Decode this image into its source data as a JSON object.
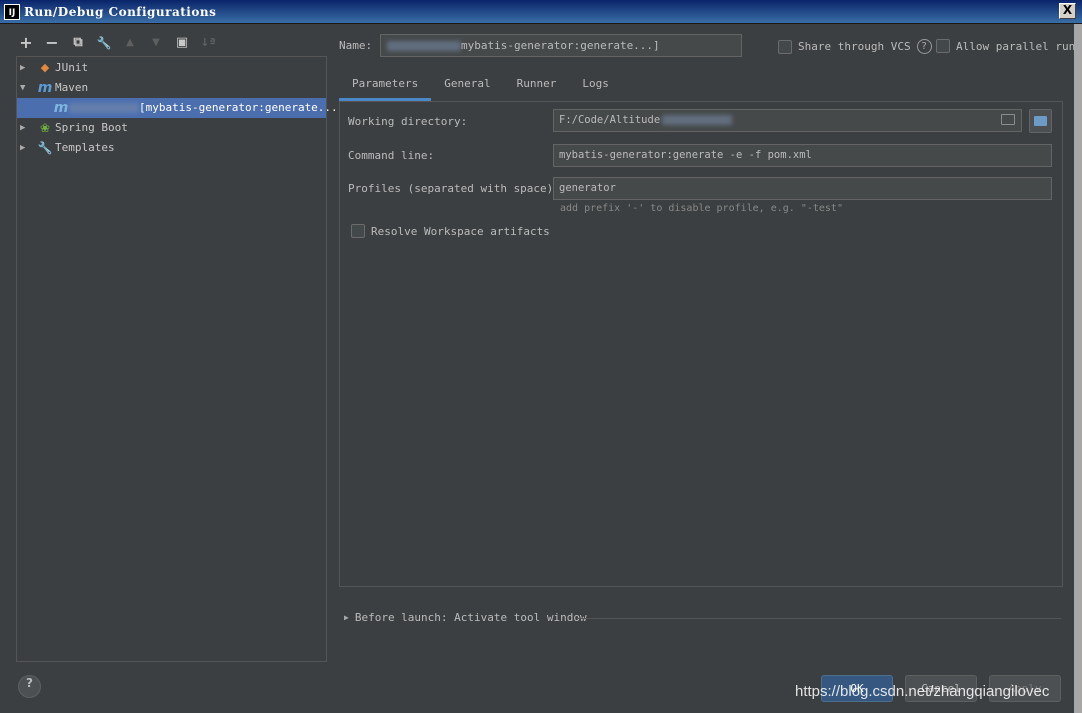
{
  "window": {
    "app_icon": "IJ",
    "title": "Run/Debug Configurations",
    "close": "X"
  },
  "toolbar": {
    "add": "+",
    "remove": "−",
    "copy": "⧉",
    "edit": "🔧",
    "up": "▲",
    "down": "▼",
    "folder": "▣",
    "sort": "↓ª"
  },
  "tree": {
    "items": [
      {
        "label": "JUnit",
        "icon": "junit-icon",
        "expanded": false
      },
      {
        "label": "Maven",
        "icon": "maven-icon",
        "expanded": true
      },
      {
        "label": "[mybatis-generator:generate...]",
        "icon": "maven-icon",
        "selected": true
      },
      {
        "label": "Spring Boot",
        "icon": "spring-boot-icon",
        "expanded": false
      },
      {
        "label": "Templates",
        "icon": "wrench-icon",
        "expanded": false
      }
    ]
  },
  "form": {
    "name_label": "Name:",
    "name_value": "mybatis-generator:generate...]",
    "share_label": "Share through VCS",
    "help": "?",
    "parallel_label": "Allow parallel run"
  },
  "tabs": [
    "Parameters",
    "General",
    "Runner",
    "Logs"
  ],
  "parameters": {
    "working_dir_label": "Working directory:",
    "working_dir_value": "F:/Code/Altitude",
    "command_line_label": "Command line:",
    "command_line_value": "mybatis-generator:generate -e -f pom.xml",
    "profiles_label": "Profiles (separated with space):",
    "profiles_value": "generator",
    "profiles_hint": "add prefix '-' to disable profile, e.g. \"-test\"",
    "resolve_label": "Resolve Workspace artifacts"
  },
  "before_launch": "Before launch: Activate tool window",
  "buttons": {
    "help": "?",
    "ok": "OK",
    "cancel": "Cancel",
    "apply": "Apply"
  },
  "watermark": "https://blog.csdn.net/zhangqiangilovec"
}
